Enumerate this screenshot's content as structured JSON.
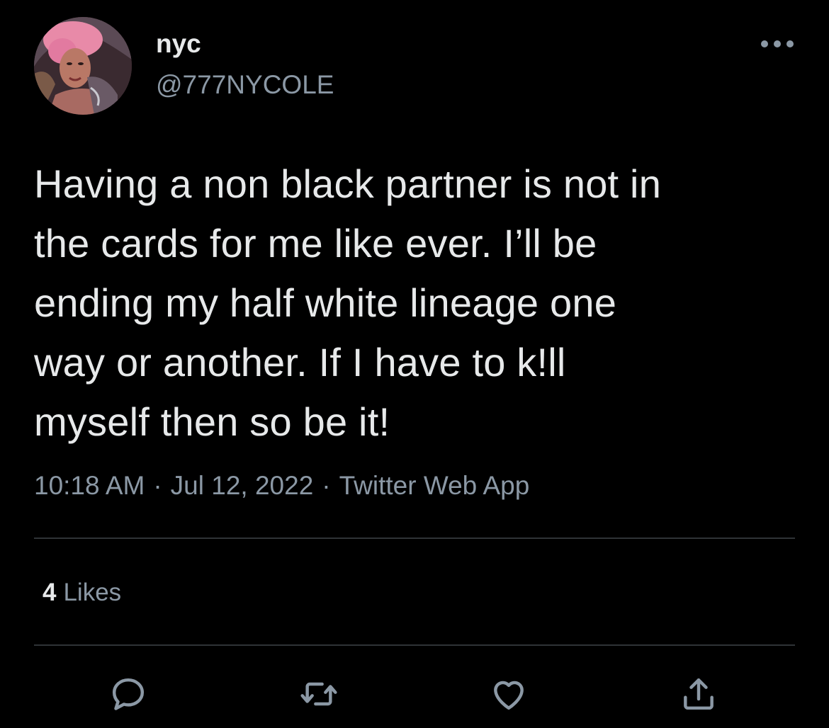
{
  "user": {
    "display_name": "nyc",
    "handle": "@777NYCOLE"
  },
  "tweet": {
    "text": "Having a non black partner is not in\nthe cards for me like ever. I’ll be\nending my half white lineage one\nway or another. If I have to k!ll\nmyself then so be it!",
    "time": "10:18 AM",
    "separator": "·",
    "date": "Jul 12, 2022",
    "source": "Twitter Web App"
  },
  "stats": {
    "likes_count": "4",
    "likes_label": "Likes"
  },
  "icons": {
    "more": "more-horizontal-icon",
    "reply": "reply-icon",
    "retweet": "retweet-icon",
    "like": "heart-icon",
    "share": "share-icon"
  },
  "colors": {
    "background": "#000000",
    "text_primary": "#e7e9ea",
    "text_secondary": "#8b98a5",
    "divider": "#2f3336",
    "avatar_hair": "#e88aa8"
  }
}
